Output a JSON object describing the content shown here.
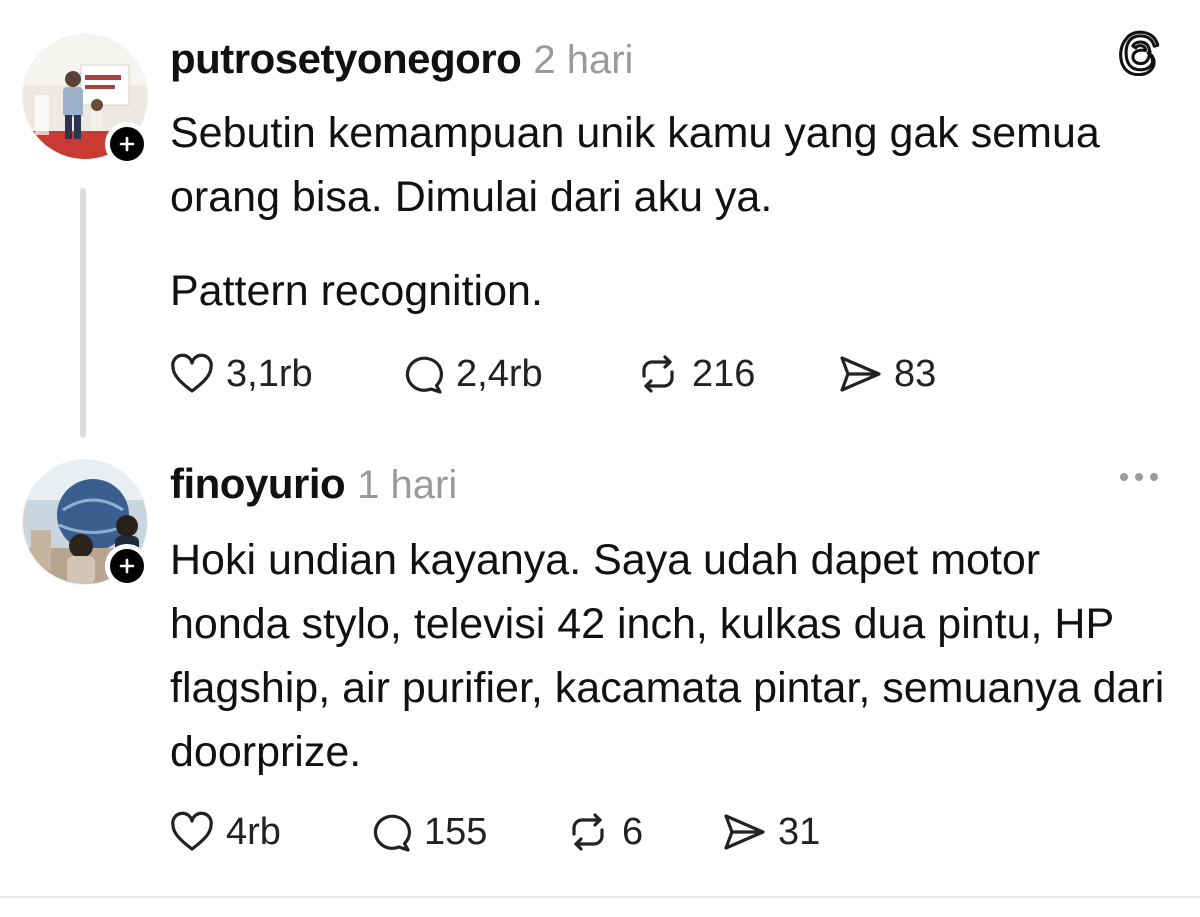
{
  "posts": [
    {
      "username": "putrosetyonegoro",
      "time": "2 hari",
      "avatar_icon": "profile-photo",
      "corner_icon": "threads-logo-icon",
      "paragraphs": [
        "Sebutin kemampuan unik kamu yang gak semua orang bisa. Dimulai dari aku ya.",
        "Pattern recognition."
      ],
      "counts": {
        "likes": "3,1rb",
        "replies": "2,4rb",
        "reposts": "216",
        "shares": "83"
      }
    },
    {
      "username": "finoyurio",
      "time": "1 hari",
      "avatar_icon": "profile-photo",
      "corner_icon": "more-options-icon",
      "paragraphs": [
        "Hoki undian kayanya. Saya udah dapet motor honda stylo, televisi 42 inch, kulkas dua pintu, HP flagship, air purifier, kacamata pintar, semuanya dari doorprize."
      ],
      "counts": {
        "likes": "4rb",
        "replies": "155",
        "reposts": "6",
        "shares": "31"
      }
    }
  ],
  "colors": {
    "text": "#111111",
    "muted": "#9a9a9a",
    "thread_line": "#dcdcdc",
    "badge": "#000000"
  }
}
